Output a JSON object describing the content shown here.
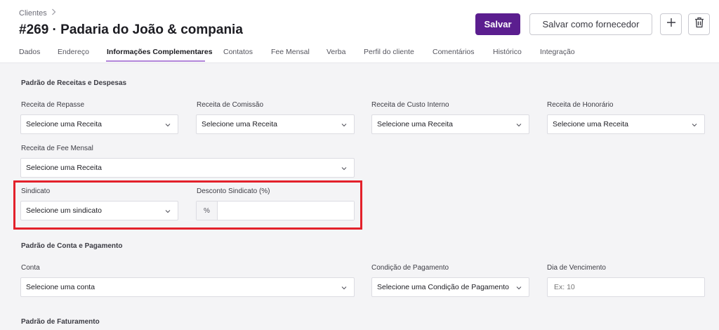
{
  "header": {
    "breadcrumb": "Clientes",
    "title": "#269 · Padaria do João & compania",
    "save_label": "Salvar",
    "save_supplier_label": "Salvar como fornecedor"
  },
  "tabs": [
    {
      "label": "Dados"
    },
    {
      "label": "Endereço"
    },
    {
      "label": "Informações Complementares",
      "active": true
    },
    {
      "label": "Contatos"
    },
    {
      "label": "Fee Mensal"
    },
    {
      "label": "Verba"
    },
    {
      "label": "Perfil do cliente"
    },
    {
      "label": "Comentários"
    },
    {
      "label": "Histórico"
    },
    {
      "label": "Integração"
    }
  ],
  "revenue_section": {
    "title": "Padrão de Receitas e Despesas",
    "repasse": {
      "label": "Receita de Repasse",
      "value": "Selecione uma Receita"
    },
    "comissao": {
      "label": "Receita de Comissão",
      "value": "Selecione uma Receita"
    },
    "custo_interno": {
      "label": "Receita de Custo Interno",
      "value": "Selecione uma Receita"
    },
    "honorario": {
      "label": "Receita de Honorário",
      "value": "Selecione uma Receita"
    },
    "fee_mensal": {
      "label": "Receita de Fee Mensal",
      "value": "Selecione uma Receita"
    },
    "sindicato": {
      "label": "Sindicato",
      "value": "Selecione um sindicato"
    },
    "desconto_sindicato": {
      "label": "Desconto Sindicato (%)",
      "prefix": "%",
      "value": ""
    }
  },
  "account_section": {
    "title": "Padrão de Conta e Pagamento",
    "conta": {
      "label": "Conta",
      "value": "Selecione uma conta"
    },
    "condicao": {
      "label": "Condição de Pagamento",
      "value": "Selecione uma Condição de Pagamento"
    },
    "vencimento": {
      "label": "Dia de Vencimento",
      "placeholder": "Ex: 10",
      "value": ""
    }
  },
  "billing_section": {
    "title": "Padrão de Faturamento"
  },
  "colors": {
    "primary": "#5b1e8f",
    "tab_underline": "#b084d8",
    "highlight": "#e3212b",
    "background": "#f4f4f6"
  },
  "icons": {
    "add": "plus-icon",
    "delete": "trash-icon",
    "breadcrumb_separator": "chevron-right-icon",
    "select_caret": "chevron-down-icon"
  }
}
